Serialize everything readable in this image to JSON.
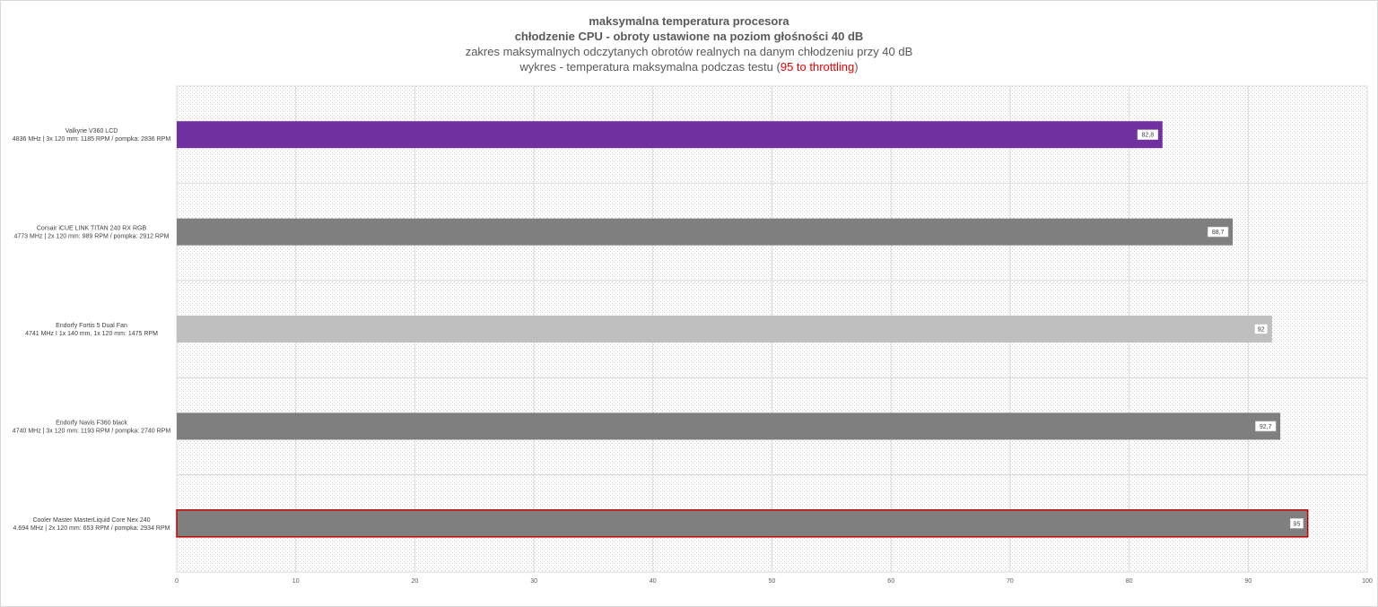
{
  "chart_data": {
    "type": "bar",
    "orientation": "horizontal",
    "title": "maksymalna temperatura procesora",
    "subtitle": "chłodzenie CPU - obroty ustawione na poziom głośności 40 dB",
    "subtitle2": "zakres maksymalnych odczytanych obrotów realnych na danym chłodzeniu przy 40 dB",
    "subtitle3_prefix": "wykres - temperatura maksymalna podczas testu (",
    "subtitle3_highlight": "95 to throttling",
    "subtitle3_suffix": ")",
    "categories": [
      {
        "name": "Valkyrie V360 LCD",
        "detail": "4836 MHz | 3x 120 mm: 1185 RPM / pompka: 2836 RPM"
      },
      {
        "name": "Corsair iCUE LINK TITAN 240 RX RGB",
        "detail": "4773 MHz | 2x 120 mm: 989 RPM / pompka: 2912 RPM"
      },
      {
        "name": "Endorfy Fortis 5 Dual Fan",
        "detail": "4741 MHz I 1x 140 mm, 1x 120 mm: 1475 RPM"
      },
      {
        "name": "Endorfy Navis F360 black",
        "detail": "4740 MHz | 3x 120 mm: 1193 RPM / pompka: 2740 RPM"
      },
      {
        "name": "Cooler Master MasterLiquid Core Nex 240",
        "detail": "4.694 MHz | 2x 120 mm: 653 RPM / pompka: 2934 RPM"
      }
    ],
    "values": [
      82.8,
      88.7,
      92,
      92.7,
      95
    ],
    "value_labels": [
      "82,8",
      "88,7",
      "92",
      "92,7",
      "95"
    ],
    "bar_colors": [
      "#7030a0",
      "#7f7f7f",
      "#bfbfbf",
      "#7f7f7f",
      "#7f7f7f"
    ],
    "highlight_outline": [
      false,
      false,
      false,
      false,
      true
    ],
    "outline_color": "#c00000",
    "xlim": [
      0,
      100
    ],
    "xticks": [
      0,
      10,
      20,
      30,
      40,
      50,
      60,
      70,
      80,
      90,
      100
    ],
    "grid": true,
    "legend": "none"
  }
}
